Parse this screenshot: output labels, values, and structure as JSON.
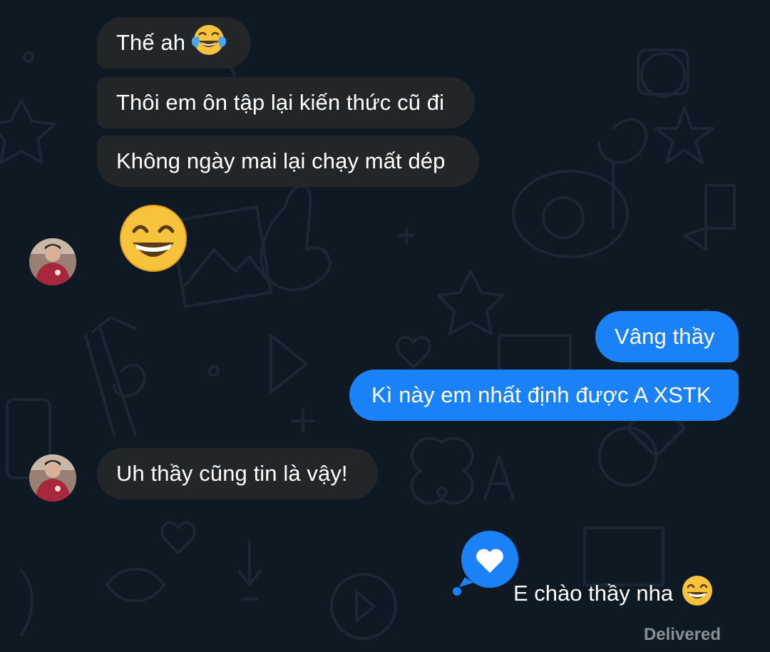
{
  "chat": {
    "messages": [
      {
        "id": "m1",
        "direction": "incoming",
        "text": "Thế ah",
        "emoji": "face-with-tears-of-joy"
      },
      {
        "id": "m2",
        "direction": "incoming",
        "text": "Thôi em ôn tập lại kiến thức cũ đi"
      },
      {
        "id": "m3",
        "direction": "incoming",
        "text": "Không ngày mai lại chạy mất dép"
      },
      {
        "id": "m4",
        "direction": "incoming",
        "emoji_only": "grinning-face"
      },
      {
        "id": "m5",
        "direction": "outgoing",
        "text": "Vâng thầy"
      },
      {
        "id": "m6",
        "direction": "outgoing",
        "text": "Kì này em nhất định được A XSTK"
      },
      {
        "id": "m7",
        "direction": "incoming",
        "text": "Uh thầy cũng tin là vậy!"
      },
      {
        "id": "m8",
        "direction": "outgoing",
        "text": "E chào thầy nha",
        "emoji": "grinning-face"
      }
    ],
    "status": "Delivered"
  },
  "colors": {
    "background": "#0f1923",
    "incoming_bubble": "#232629",
    "outgoing_bubble": "#1a82f6",
    "text": "#ffffff",
    "status_text": "#8b8f94"
  },
  "icons": {
    "heart_reply": "heart-speech-bubble-icon",
    "avatar": "contact-avatar"
  }
}
